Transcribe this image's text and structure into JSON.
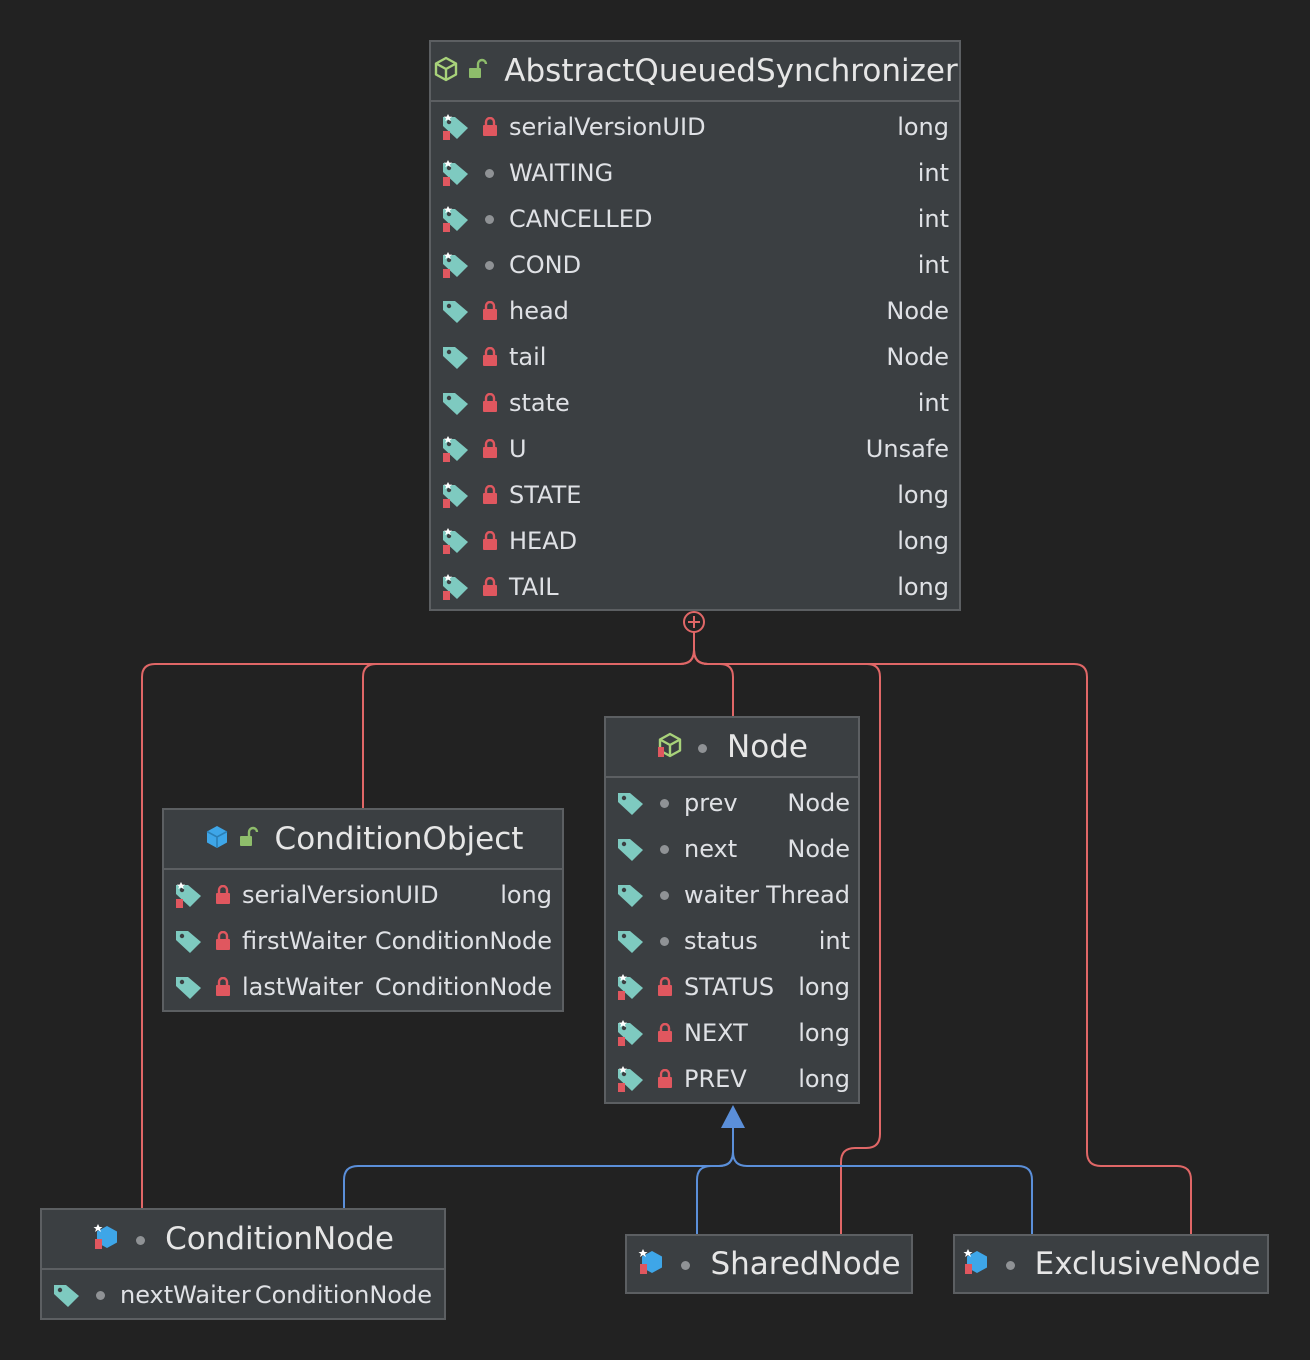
{
  "classes": {
    "aqs": {
      "name": "AbstractQueuedSynchronizer",
      "fields": [
        {
          "name": "serialVersionUID",
          "type": "long"
        },
        {
          "name": "WAITING",
          "type": "int"
        },
        {
          "name": "CANCELLED",
          "type": "int"
        },
        {
          "name": "COND",
          "type": "int"
        },
        {
          "name": "head",
          "type": "Node"
        },
        {
          "name": "tail",
          "type": "Node"
        },
        {
          "name": "state",
          "type": "int"
        },
        {
          "name": "U",
          "type": "Unsafe"
        },
        {
          "name": "STATE",
          "type": "long"
        },
        {
          "name": "HEAD",
          "type": "long"
        },
        {
          "name": "TAIL",
          "type": "long"
        }
      ]
    },
    "node": {
      "name": "Node",
      "fields": [
        {
          "name": "prev",
          "type": "Node"
        },
        {
          "name": "next",
          "type": "Node"
        },
        {
          "name": "waiter",
          "type": "Thread"
        },
        {
          "name": "status",
          "type": "int"
        },
        {
          "name": "STATUS",
          "type": "long"
        },
        {
          "name": "NEXT",
          "type": "long"
        },
        {
          "name": "PREV",
          "type": "long"
        }
      ]
    },
    "condition_object": {
      "name": "ConditionObject",
      "fields": [
        {
          "name": "serialVersionUID",
          "type": "long"
        },
        {
          "name": "firstWaiter",
          "type": "ConditionNode"
        },
        {
          "name": "lastWaiter",
          "type": "ConditionNode"
        }
      ]
    },
    "condition_node": {
      "name": "ConditionNode",
      "fields": [
        {
          "name": "nextWaiter",
          "type": "ConditionNode"
        }
      ]
    },
    "shared_node": {
      "name": "SharedNode"
    },
    "exclusive_node": {
      "name": "ExclusiveNode"
    }
  },
  "relations": {
    "inner_class_edges": [
      "AbstractQueuedSynchronizer → Node",
      "AbstractQueuedSynchronizer → ConditionObject",
      "AbstractQueuedSynchronizer → ConditionNode",
      "AbstractQueuedSynchronizer → SharedNode",
      "AbstractQueuedSynchronizer → ExclusiveNode"
    ],
    "inheritance_edges": [
      "ConditionNode → Node",
      "SharedNode → Node",
      "ExclusiveNode → Node"
    ]
  },
  "colors": {
    "background": "#222222",
    "box": "#3b3f42",
    "border": "#5c5f62",
    "inner_edge": "#e06767",
    "inherit_edge": "#5b8fd9",
    "tag": "#7ecac0",
    "lock": "#e0575f",
    "open_lock": "#8ebd6b"
  }
}
